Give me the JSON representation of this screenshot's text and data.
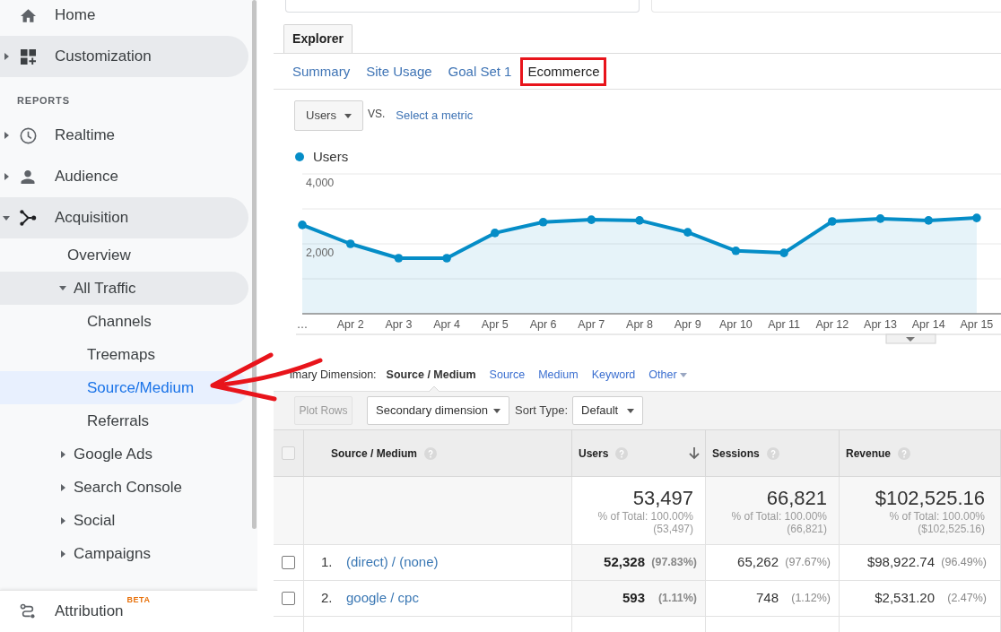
{
  "sidebar": {
    "items": [
      {
        "label": "Home",
        "kind": "link",
        "highlighted": false,
        "selected": false
      },
      {
        "label": "Customization",
        "kind": "group",
        "expanded": false,
        "highlighted": true,
        "selected": false
      }
    ],
    "section_title": "REPORTS",
    "reports": [
      {
        "label": "Realtime",
        "kind": "group",
        "expanded": false,
        "highlighted": false,
        "selected": false
      },
      {
        "label": "Audience",
        "kind": "group",
        "expanded": false,
        "highlighted": false,
        "selected": false
      },
      {
        "label": "Acquisition",
        "kind": "group",
        "expanded": true,
        "highlighted": true,
        "selected": false,
        "children": [
          {
            "label": "Overview",
            "kind": "link",
            "highlighted": false,
            "selected": false
          },
          {
            "label": "All Traffic",
            "kind": "group",
            "expanded": true,
            "highlighted": true,
            "selected": false,
            "children": [
              {
                "label": "Channels",
                "kind": "link",
                "highlighted": false,
                "selected": false
              },
              {
                "label": "Treemaps",
                "kind": "link",
                "highlighted": false,
                "selected": false
              },
              {
                "label": "Source/Medium",
                "kind": "link",
                "highlighted": false,
                "selected": true
              },
              {
                "label": "Referrals",
                "kind": "link",
                "highlighted": false,
                "selected": false
              }
            ]
          },
          {
            "label": "Google Ads",
            "kind": "group",
            "expanded": false,
            "highlighted": false,
            "selected": false
          },
          {
            "label": "Search Console",
            "kind": "group",
            "expanded": false,
            "highlighted": false,
            "selected": false
          },
          {
            "label": "Social",
            "kind": "group",
            "expanded": false,
            "highlighted": false,
            "selected": false
          },
          {
            "label": "Campaigns",
            "kind": "group",
            "expanded": false,
            "highlighted": false,
            "selected": false
          }
        ]
      }
    ],
    "footer": {
      "label": "Attribution",
      "badge": "BETA"
    }
  },
  "explorer": {
    "view_tab": "Explorer",
    "tabs": [
      {
        "label": "Summary",
        "selected": false,
        "highlighted": false
      },
      {
        "label": "Site Usage",
        "selected": false,
        "highlighted": false
      },
      {
        "label": "Goal Set 1",
        "selected": false,
        "highlighted": false
      },
      {
        "label": "Ecommerce",
        "selected": true,
        "highlighted": true
      }
    ],
    "metric": "Users",
    "vs": "VS.",
    "compare_link": "Select a metric",
    "chart_data": {
      "type": "area",
      "categories": [
        "…",
        "Apr 2",
        "Apr 3",
        "Apr 4",
        "Apr 5",
        "Apr 6",
        "Apr 7",
        "Apr 8",
        "Apr 9",
        "Apr 10",
        "Apr 11",
        "Apr 12",
        "Apr 13",
        "Apr 14",
        "Apr 15"
      ],
      "series": [
        {
          "name": "Users",
          "color": "#058dc7",
          "values": [
            2540,
            2000,
            1590,
            1590,
            2310,
            2620,
            2690,
            2670,
            2330,
            1800,
            1740,
            2640,
            2720,
            2670,
            2740
          ]
        }
      ],
      "ylim": [
        0,
        4000
      ],
      "yticks": [
        {
          "value": 2000,
          "label": "2,000"
        },
        {
          "value": 4000,
          "label": "4,000"
        }
      ]
    }
  },
  "dimension_bar": {
    "label": "imary Dimension:",
    "options": [
      {
        "label": "Source / Medium",
        "kind": "link",
        "selected": true
      },
      {
        "label": "Source",
        "kind": "link",
        "selected": false
      },
      {
        "label": "Medium",
        "kind": "link",
        "selected": false
      },
      {
        "label": "Keyword",
        "kind": "link",
        "selected": false
      },
      {
        "label": "Other",
        "kind": "menu",
        "selected": false
      }
    ]
  },
  "toolbar": {
    "plot_rows": {
      "label": "Plot Rows",
      "disabled": true
    },
    "secondary_dimension": "Secondary dimension",
    "sort_label": "Sort Type:",
    "sort_type": "Default"
  },
  "table": {
    "select_all": {
      "checked": false,
      "disabled": true
    },
    "columns": [
      {
        "label": "Source / Medium",
        "sorted": false
      },
      {
        "label": "Users",
        "sorted": true
      },
      {
        "label": "Sessions",
        "sorted": false
      },
      {
        "label": "Revenue",
        "sorted": false
      }
    ],
    "totals": [
      {
        "value": "53,497",
        "share": "% of Total: 100.00%",
        "total": "(53,497)"
      },
      {
        "value": "66,821",
        "share": "% of Total: 100.00%",
        "total": "(66,821)"
      },
      {
        "value": "$102,525.16",
        "share": "% of Total: 100.00%",
        "total": "($102,525.16)"
      }
    ],
    "rows": [
      {
        "rank": "1.",
        "label": "(direct) / (none)",
        "checked": false,
        "cells": [
          {
            "value": "52,328",
            "percent": "(97.83%)"
          },
          {
            "value": "65,262",
            "percent": "(97.67%)"
          },
          {
            "value": "$98,922.74",
            "percent": "(96.49%)"
          }
        ]
      },
      {
        "rank": "2.",
        "label": "google / cpc",
        "checked": false,
        "cells": [
          {
            "value": "593",
            "percent": "(1.11%)"
          },
          {
            "value": "748",
            "percent": "(1.12%)"
          },
          {
            "value": "$2,531.20",
            "percent": "(2.47%)"
          }
        ]
      }
    ]
  },
  "annotations": [
    {
      "kind": "arrow"
    }
  ]
}
